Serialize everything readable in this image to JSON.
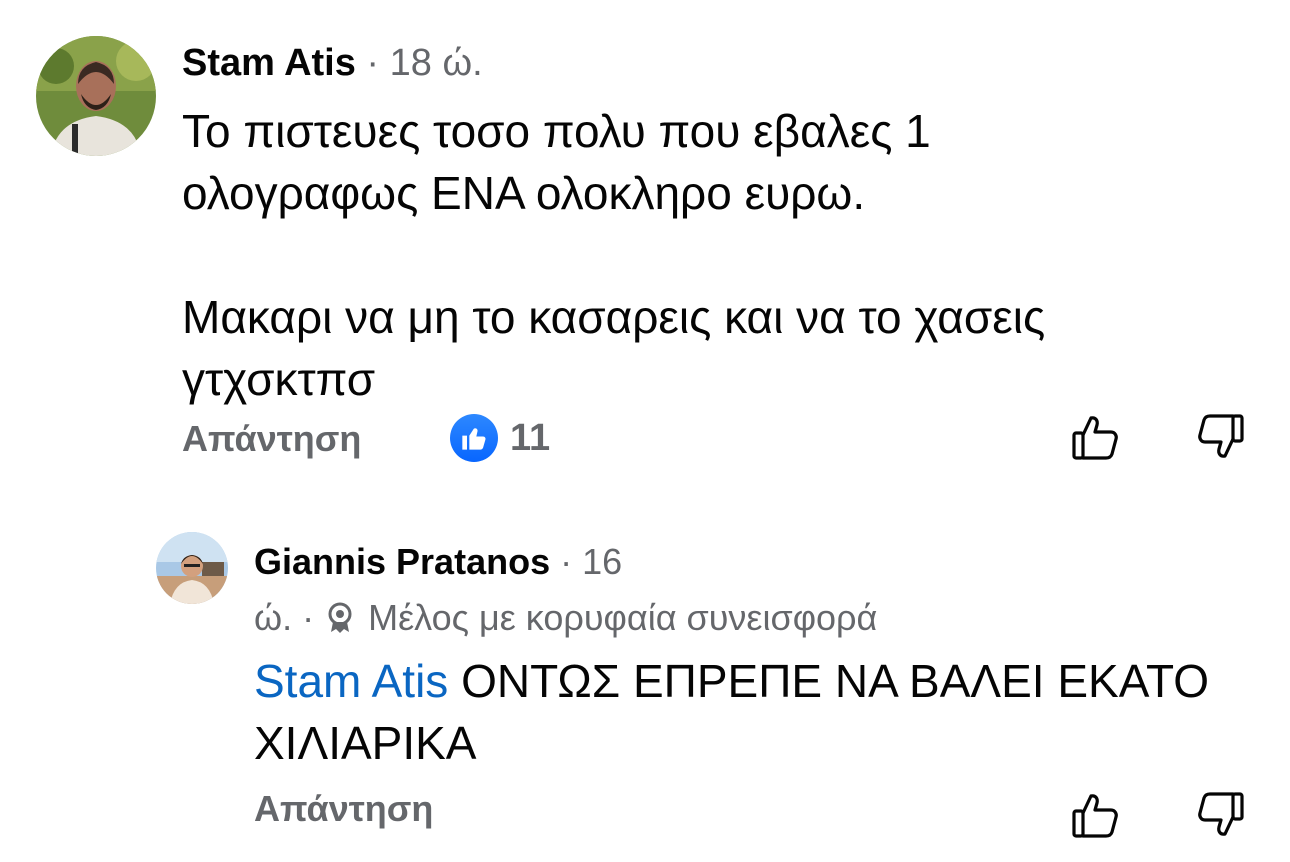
{
  "comment": {
    "author": "Stam Atis",
    "time": "· 18 ώ.",
    "body_lines": [
      "Το πιστευες τοσο πολυ που εβαλες 1",
      "ολογραφως ΕΝΑ ολοκληρο ευρω.",
      "Μακαρι να μη το κασαρεις και να το χασεις",
      "γτχσκτπσ"
    ],
    "reply_label": "Απάντηση",
    "reaction_icon": "like-icon",
    "reaction_count": "11",
    "upvote_icon": "thumbs-up-outline-icon",
    "downvote_icon": "thumbs-down-outline-icon"
  },
  "reply": {
    "author": "Giannis Pratanos",
    "time_prefix": "· 16",
    "time_suffix": "ώ. ·",
    "badge_icon": "top-contributor-badge-icon",
    "badge_label": "Μέλος με κορυφαία συνεισφορά",
    "mention": "Stam Atis",
    "body_text": " ΟΝΤΩΣ ΕΠΡΕΠΕ ΝΑ ΒΑΛΕΙ ΕΚΑΤΟ ΧΙΛΙΑΡΙΚΑ",
    "reply_label": "Απάντηση"
  },
  "colors": {
    "text": "#050505",
    "secondary": "#65676b",
    "mention": "#0a66c2",
    "like_blue": "#0866ff"
  }
}
